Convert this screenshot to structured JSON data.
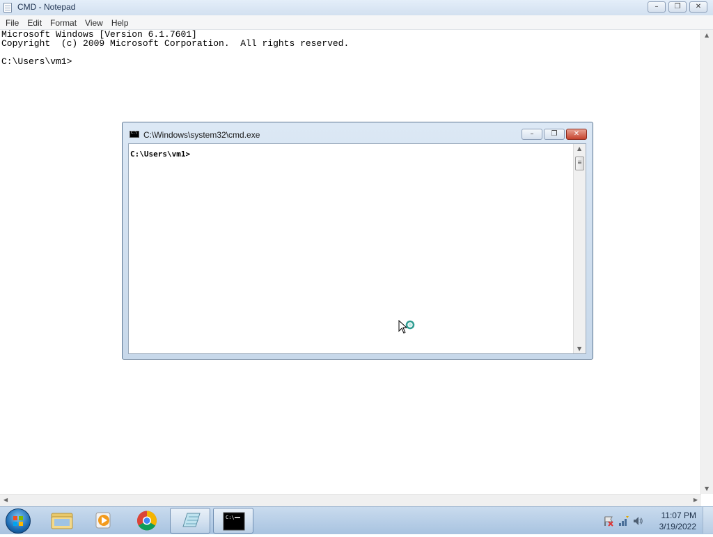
{
  "notepad": {
    "title": "CMD - Notepad",
    "menu": [
      "File",
      "Edit",
      "Format",
      "View",
      "Help"
    ],
    "text_lines": [
      "Microsoft Windows [Version 6.1.7601]",
      "Copyright  (c) 2009 Microsoft Corporation.  All rights reserved.",
      "",
      "C:\\Users\\vm1>"
    ],
    "caption": {
      "minimize": "–",
      "restore": "❐",
      "close": "✕"
    }
  },
  "cmd": {
    "title": "C:\\Windows\\system32\\cmd.exe",
    "prompt": "C:\\Users\\vm1>",
    "caption": {
      "minimize": "–",
      "restore": "❐",
      "close": "✕"
    }
  },
  "taskbar": {
    "apps": [
      "windows-explorer",
      "windows-media-player",
      "google-chrome",
      "notepad",
      "command-prompt"
    ],
    "clock_time": "11:07 PM",
    "clock_date": "3/19/2022",
    "tray_icons": [
      "action-center-flag-icon",
      "network-icon",
      "volume-icon"
    ]
  }
}
